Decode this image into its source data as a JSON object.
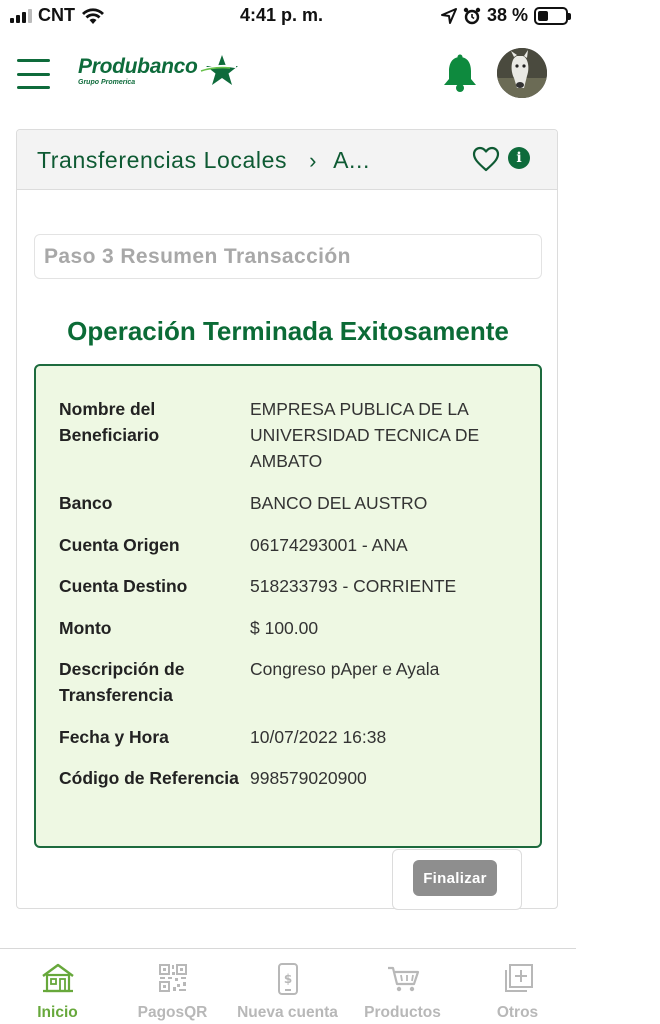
{
  "status_bar": {
    "carrier": "CNT",
    "time": "4:41 p. m.",
    "battery": "38 %",
    "battery_level": 0.38
  },
  "header": {
    "brand": "Produbanco",
    "brand_sub": "Grupo Promerica"
  },
  "breadcrumb": {
    "title": "Transferencias Locales",
    "next": "A..."
  },
  "step_title": "Paso 3 Resumen Transacción",
  "success_message": "Operación Terminada Exitosamente",
  "summary": [
    {
      "label": "Nombre del Beneficiario",
      "value": "EMPRESA PUBLICA DE LA UNIVERSIDAD TECNICA DE AMBATO"
    },
    {
      "label": "Banco",
      "value": "BANCO DEL AUSTRO"
    },
    {
      "label": "Cuenta Origen",
      "value": "06174293001 - ANA"
    },
    {
      "label": "Cuenta Destino",
      "value": "518233793 - CORRIENTE"
    },
    {
      "label": "Monto",
      "value": "$ 100.00"
    },
    {
      "label": "Descripción de Transferencia",
      "value": "Congreso pAper e Ayala"
    },
    {
      "label": "Fecha y Hora",
      "value": "10/07/2022 16:38"
    },
    {
      "label": "Código de Referencia",
      "value": "998579020900"
    }
  ],
  "finish_label": "Finalizar",
  "bottom_nav": [
    {
      "label": "Inicio",
      "icon": "home-icon",
      "active": true
    },
    {
      "label": "PagosQR",
      "icon": "qr-code-icon",
      "active": false
    },
    {
      "label": "Nueva cuenta",
      "icon": "phone-dollar-icon",
      "active": false
    },
    {
      "label": "Productos",
      "icon": "cart-icon",
      "active": false
    },
    {
      "label": "Otros",
      "icon": "add-square-icon",
      "active": false
    }
  ],
  "colors": {
    "brand_green": "#0e6b3b",
    "summary_bg": "#eef8e3",
    "active_nav": "#67a83b",
    "inactive_nav": "#b8b8b8"
  }
}
